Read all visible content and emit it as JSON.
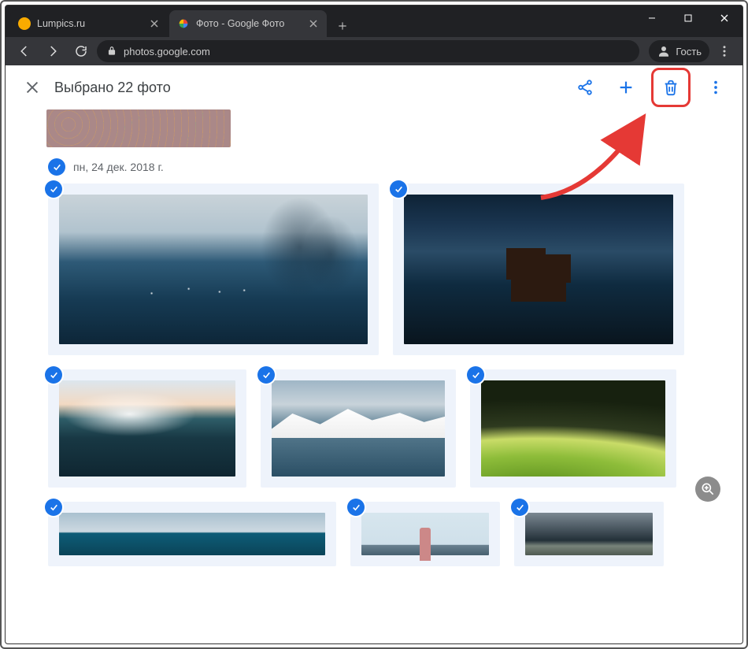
{
  "window": {
    "minimize": "–",
    "maximize": "☐",
    "close": "✕"
  },
  "tabs": [
    {
      "title": "Lumpics.ru",
      "active": false
    },
    {
      "title": "Фото - Google Фото",
      "active": true
    }
  ],
  "addressbar": {
    "url": "photos.google.com"
  },
  "profile": {
    "label": "Гость"
  },
  "header": {
    "selection_text": "Выбрано 22 фото",
    "actions": {
      "share": "share-icon",
      "add": "plus-icon",
      "delete": "trash-icon",
      "more": "more-icon"
    }
  },
  "date_group": {
    "label": "пн, 24 дек. 2018 г."
  },
  "photos_row1": [
    {
      "name": "boats-photo",
      "selected": true
    },
    {
      "name": "castle-photo",
      "selected": true
    }
  ],
  "photos_row2": [
    {
      "name": "hill-photo",
      "selected": true
    },
    {
      "name": "lake-photo",
      "selected": true
    },
    {
      "name": "green-hills-photo",
      "selected": true
    }
  ],
  "photos_row3": [
    {
      "name": "sea-photo",
      "selected": true
    },
    {
      "name": "lighthouse-photo",
      "selected": true
    },
    {
      "name": "storm-photo",
      "selected": true
    }
  ],
  "annotation": {
    "highlight_target": "delete-button"
  },
  "colors": {
    "accent": "#1a73e8",
    "highlight": "#e53935"
  }
}
